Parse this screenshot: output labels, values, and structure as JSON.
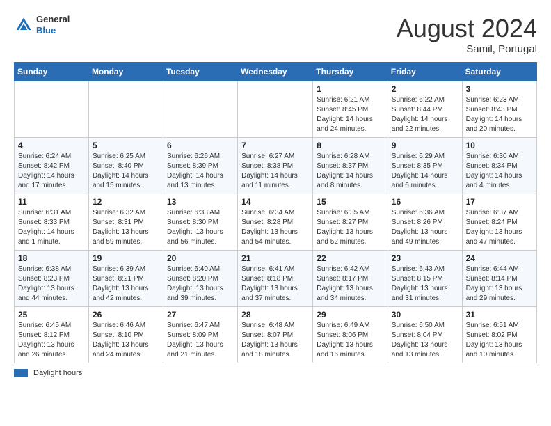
{
  "header": {
    "logo_general": "General",
    "logo_blue": "Blue",
    "month_title": "August 2024",
    "location": "Samil, Portugal"
  },
  "days_of_week": [
    "Sunday",
    "Monday",
    "Tuesday",
    "Wednesday",
    "Thursday",
    "Friday",
    "Saturday"
  ],
  "legend": {
    "label": "Daylight hours"
  },
  "weeks": [
    {
      "days": [
        {
          "number": "",
          "info": ""
        },
        {
          "number": "",
          "info": ""
        },
        {
          "number": "",
          "info": ""
        },
        {
          "number": "",
          "info": ""
        },
        {
          "number": "1",
          "info": "Sunrise: 6:21 AM\nSunset: 8:45 PM\nDaylight: 14 hours and 24 minutes."
        },
        {
          "number": "2",
          "info": "Sunrise: 6:22 AM\nSunset: 8:44 PM\nDaylight: 14 hours and 22 minutes."
        },
        {
          "number": "3",
          "info": "Sunrise: 6:23 AM\nSunset: 8:43 PM\nDaylight: 14 hours and 20 minutes."
        }
      ]
    },
    {
      "days": [
        {
          "number": "4",
          "info": "Sunrise: 6:24 AM\nSunset: 8:42 PM\nDaylight: 14 hours and 17 minutes."
        },
        {
          "number": "5",
          "info": "Sunrise: 6:25 AM\nSunset: 8:40 PM\nDaylight: 14 hours and 15 minutes."
        },
        {
          "number": "6",
          "info": "Sunrise: 6:26 AM\nSunset: 8:39 PM\nDaylight: 14 hours and 13 minutes."
        },
        {
          "number": "7",
          "info": "Sunrise: 6:27 AM\nSunset: 8:38 PM\nDaylight: 14 hours and 11 minutes."
        },
        {
          "number": "8",
          "info": "Sunrise: 6:28 AM\nSunset: 8:37 PM\nDaylight: 14 hours and 8 minutes."
        },
        {
          "number": "9",
          "info": "Sunrise: 6:29 AM\nSunset: 8:35 PM\nDaylight: 14 hours and 6 minutes."
        },
        {
          "number": "10",
          "info": "Sunrise: 6:30 AM\nSunset: 8:34 PM\nDaylight: 14 hours and 4 minutes."
        }
      ]
    },
    {
      "days": [
        {
          "number": "11",
          "info": "Sunrise: 6:31 AM\nSunset: 8:33 PM\nDaylight: 14 hours and 1 minute."
        },
        {
          "number": "12",
          "info": "Sunrise: 6:32 AM\nSunset: 8:31 PM\nDaylight: 13 hours and 59 minutes."
        },
        {
          "number": "13",
          "info": "Sunrise: 6:33 AM\nSunset: 8:30 PM\nDaylight: 13 hours and 56 minutes."
        },
        {
          "number": "14",
          "info": "Sunrise: 6:34 AM\nSunset: 8:28 PM\nDaylight: 13 hours and 54 minutes."
        },
        {
          "number": "15",
          "info": "Sunrise: 6:35 AM\nSunset: 8:27 PM\nDaylight: 13 hours and 52 minutes."
        },
        {
          "number": "16",
          "info": "Sunrise: 6:36 AM\nSunset: 8:26 PM\nDaylight: 13 hours and 49 minutes."
        },
        {
          "number": "17",
          "info": "Sunrise: 6:37 AM\nSunset: 8:24 PM\nDaylight: 13 hours and 47 minutes."
        }
      ]
    },
    {
      "days": [
        {
          "number": "18",
          "info": "Sunrise: 6:38 AM\nSunset: 8:23 PM\nDaylight: 13 hours and 44 minutes."
        },
        {
          "number": "19",
          "info": "Sunrise: 6:39 AM\nSunset: 8:21 PM\nDaylight: 13 hours and 42 minutes."
        },
        {
          "number": "20",
          "info": "Sunrise: 6:40 AM\nSunset: 8:20 PM\nDaylight: 13 hours and 39 minutes."
        },
        {
          "number": "21",
          "info": "Sunrise: 6:41 AM\nSunset: 8:18 PM\nDaylight: 13 hours and 37 minutes."
        },
        {
          "number": "22",
          "info": "Sunrise: 6:42 AM\nSunset: 8:17 PM\nDaylight: 13 hours and 34 minutes."
        },
        {
          "number": "23",
          "info": "Sunrise: 6:43 AM\nSunset: 8:15 PM\nDaylight: 13 hours and 31 minutes."
        },
        {
          "number": "24",
          "info": "Sunrise: 6:44 AM\nSunset: 8:14 PM\nDaylight: 13 hours and 29 minutes."
        }
      ]
    },
    {
      "days": [
        {
          "number": "25",
          "info": "Sunrise: 6:45 AM\nSunset: 8:12 PM\nDaylight: 13 hours and 26 minutes."
        },
        {
          "number": "26",
          "info": "Sunrise: 6:46 AM\nSunset: 8:10 PM\nDaylight: 13 hours and 24 minutes."
        },
        {
          "number": "27",
          "info": "Sunrise: 6:47 AM\nSunset: 8:09 PM\nDaylight: 13 hours and 21 minutes."
        },
        {
          "number": "28",
          "info": "Sunrise: 6:48 AM\nSunset: 8:07 PM\nDaylight: 13 hours and 18 minutes."
        },
        {
          "number": "29",
          "info": "Sunrise: 6:49 AM\nSunset: 8:06 PM\nDaylight: 13 hours and 16 minutes."
        },
        {
          "number": "30",
          "info": "Sunrise: 6:50 AM\nSunset: 8:04 PM\nDaylight: 13 hours and 13 minutes."
        },
        {
          "number": "31",
          "info": "Sunrise: 6:51 AM\nSunset: 8:02 PM\nDaylight: 13 hours and 10 minutes."
        }
      ]
    }
  ]
}
